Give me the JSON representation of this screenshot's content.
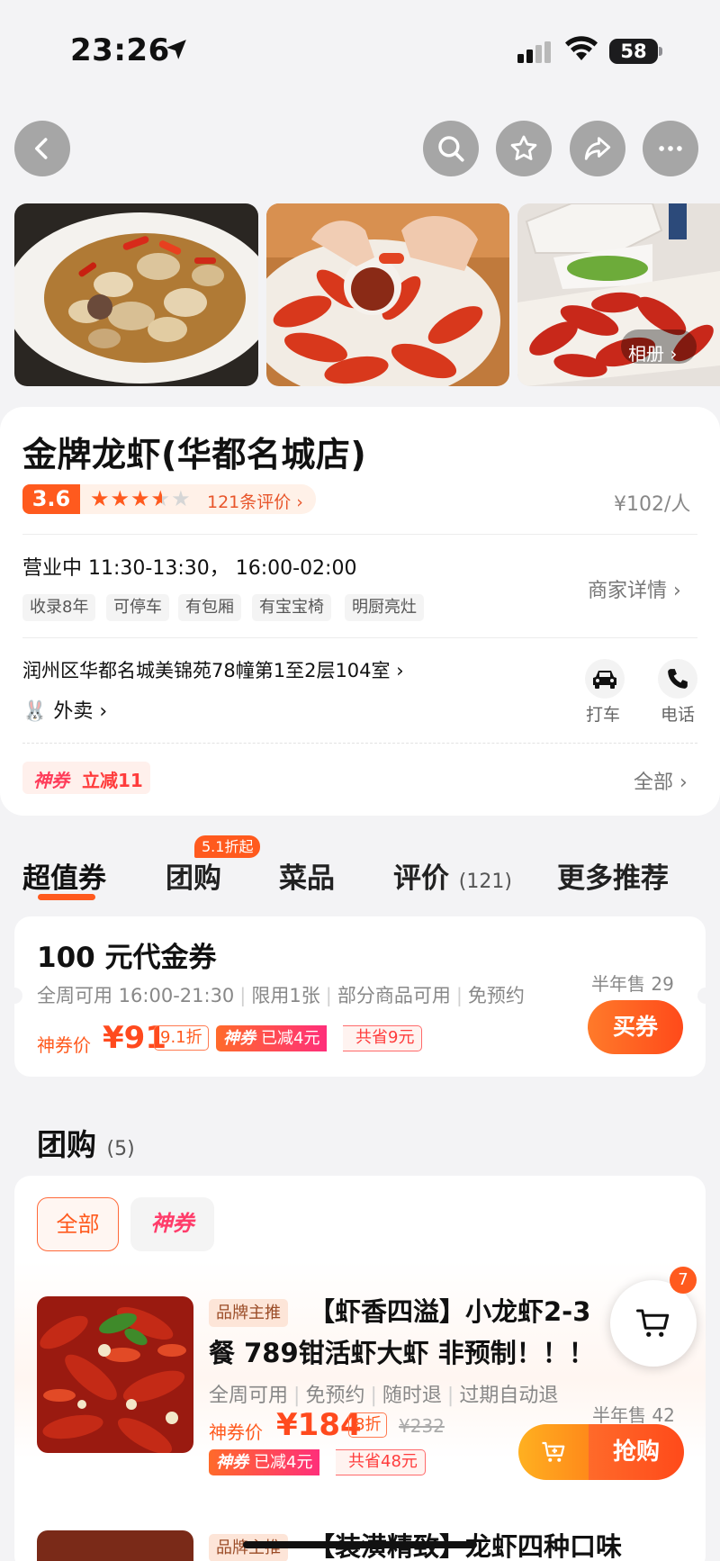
{
  "status_bar": {
    "time": "23:26",
    "battery": "58"
  },
  "gallery": {
    "album_label": "相册"
  },
  "shop": {
    "name": "金牌龙虾(华都名城店)",
    "score": "3.6",
    "review_count": "121条评价",
    "avg_price": "¥102/人",
    "hours": "营业中 11:30-13:30， 16:00-02:00",
    "tags": [
      "收录8年",
      "可停车",
      "有包厢",
      "有宝宝椅",
      "明厨亮灶"
    ],
    "merchant_details": "商家详情",
    "address": "润州区华都名城美锦苑78幢第1至2层104室",
    "takeout": "外卖",
    "actions": {
      "taxi": "打车",
      "phone": "电话"
    },
    "coupon_brand": "神券",
    "coupon_offer": "立减11",
    "all_label": "全部"
  },
  "tabs": {
    "items": [
      "超值券",
      "团购",
      "菜品",
      "评价",
      "更多推荐"
    ],
    "review_count": "(121)",
    "group_badge": "5.1折起"
  },
  "voucher": {
    "title": "100 元代金券",
    "desc": [
      "全周可用 16:00-21:30",
      "限用1张",
      "部分商品可用",
      "免预约"
    ],
    "sold": "半年售 29",
    "price_label": "神券价",
    "price": "¥91",
    "discount": "9.1折",
    "god_label": "神券",
    "reduced": "已减4元",
    "saved": "共省9元",
    "buy": "买券"
  },
  "group_buy": {
    "title": "团购",
    "count": "(5)",
    "filters": [
      "全部",
      "神券"
    ],
    "deal1": {
      "brand_tag": "品牌主推",
      "title_line1": "【虾香四溢】小龙虾2-3",
      "title_line2": "餐 789钳活虾大虾 非预制！！！",
      "desc": [
        "全周可用",
        "免预约",
        "随时退",
        "过期自动退"
      ],
      "sold": "半年售 42",
      "price_label": "神券价",
      "price": "¥184",
      "discount": "8折",
      "original": "¥232",
      "god_label": "神券",
      "reduced": "已减4元",
      "saved": "共省48元",
      "grab": "抢购"
    },
    "deal2": {
      "brand_tag": "品牌主推",
      "title": "【装潢精致】龙虾四种口味"
    }
  },
  "cart": {
    "badge": "7"
  },
  "colors": {
    "accent": "#ff5a1e",
    "coupon_pink": "#ff3c6a",
    "background": "#f3f3f5"
  }
}
